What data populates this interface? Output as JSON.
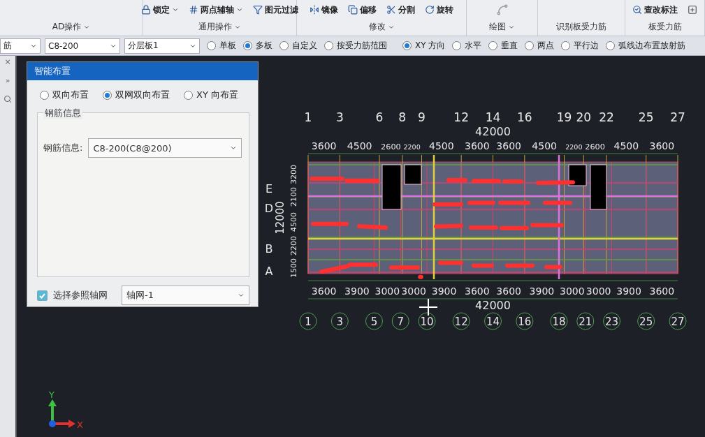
{
  "ribbon": [
    {
      "label": "AD操作"
    },
    {
      "label": "通用操作",
      "items": [
        {
          "text": "锁定",
          "caret": true
        },
        {
          "text": "两点辅轴",
          "caret": true
        },
        {
          "text": "图元过滤",
          "caret": false
        }
      ]
    },
    {
      "label": "修改",
      "items": [
        {
          "text": "镜像",
          "caret": false
        },
        {
          "text": "偏移",
          "caret": false
        },
        {
          "text": "分割",
          "caret": false
        },
        {
          "text": "旋转",
          "caret": false
        }
      ]
    },
    {
      "label": "绘图"
    },
    {
      "label": "识别板受力筋"
    },
    {
      "label": "板受力筋",
      "items": [
        {
          "text": "查改标注",
          "caret": false
        }
      ]
    }
  ],
  "toolbar": {
    "dropdowns": [
      "筋",
      "C8-200",
      "分层板1"
    ],
    "radios": [
      {
        "label": "单板",
        "selected": false
      },
      {
        "label": "多板",
        "selected": true
      },
      {
        "label": "自定义",
        "selected": false
      },
      {
        "label": "按受力筋范围",
        "selected": false
      }
    ],
    "directions": [
      {
        "label": "XY 方向",
        "selected": true
      },
      {
        "label": "水平",
        "selected": false
      },
      {
        "label": "垂直",
        "selected": false
      },
      {
        "label": "两点",
        "selected": false
      },
      {
        "label": "平行边",
        "selected": false
      },
      {
        "label": "弧线边布置放射筋",
        "selected": false
      }
    ]
  },
  "side_panel": {
    "close": "×",
    "expand": "»"
  },
  "dialog": {
    "title": "智能布置",
    "modes": [
      {
        "label": "双向布置",
        "selected": false
      },
      {
        "label": "双网双向布置",
        "selected": true
      },
      {
        "label": "XY 向布置",
        "selected": false
      }
    ],
    "group_title": "钢筋信息",
    "field_label": "钢筋信息:",
    "field_value": "C8-200(C8@200)",
    "reference": {
      "label": "选择参照轴网",
      "checked": true,
      "value": "轴网-1"
    }
  },
  "drawing": {
    "top_axes": [
      "1",
      "3",
      "6",
      "8",
      "9",
      "12",
      "14",
      "16",
      "19",
      "20",
      "22",
      "25",
      "27"
    ],
    "top_spans": [
      "3600",
      "4500",
      "2600",
      "2200",
      "4500",
      "3600",
      "3600",
      "4500",
      "2200",
      "2600",
      "4500",
      "3600"
    ],
    "top_total": "42000",
    "bottom_axes": [
      "1",
      "3",
      "5",
      "7",
      "10",
      "12",
      "14",
      "16",
      "18",
      "21",
      "23",
      "25",
      "27"
    ],
    "bottom_spans": [
      "3600",
      "3900",
      "3000",
      "3000",
      "3900",
      "3600",
      "3600",
      "3900",
      "3000",
      "3000",
      "3900",
      "3600"
    ],
    "bottom_total": "42000",
    "rows": [
      "E",
      "D",
      "B",
      "A"
    ],
    "left_spans": [
      "3200",
      "2100",
      "4500",
      "2200",
      "1500"
    ],
    "left_total": "12000"
  },
  "axis_indicator": {
    "x": "X",
    "y": "Y"
  }
}
